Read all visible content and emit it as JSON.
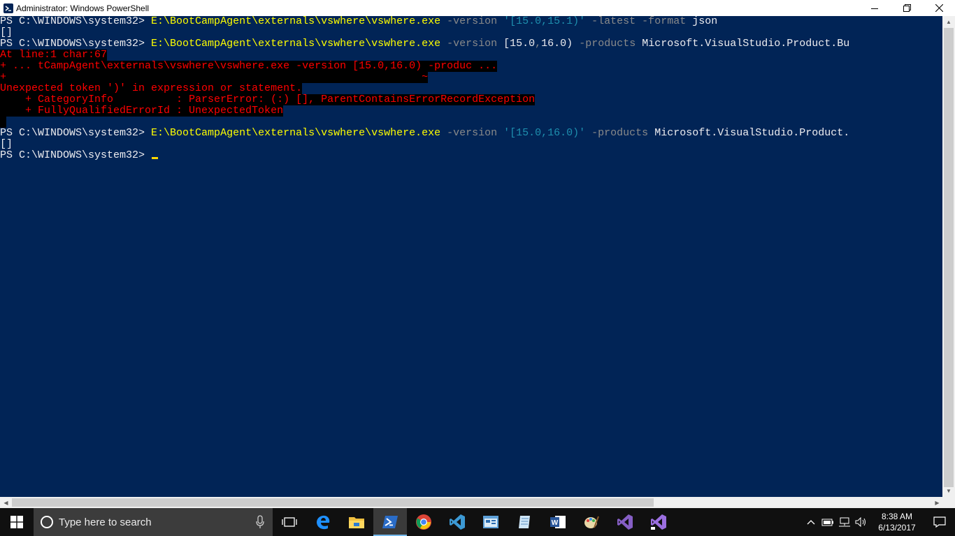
{
  "window": {
    "title": "Administrator: Windows PowerShell",
    "icon": "powershell-icon"
  },
  "console": {
    "lines": [
      {
        "segments": [
          {
            "t": "PS C:\\WINDOWS\\system32> ",
            "c": "white"
          },
          {
            "t": "E:\\BootCampAgent\\externals\\vswhere\\vswhere.exe",
            "c": "yellow"
          },
          {
            "t": " -version ",
            "c": "gray"
          },
          {
            "t": "'[15.0,15.1)'",
            "c": "str"
          },
          {
            "t": " -latest -format ",
            "c": "gray"
          },
          {
            "t": "json",
            "c": "white"
          }
        ]
      },
      {
        "segments": [
          {
            "t": "[]",
            "c": "white"
          }
        ]
      },
      {
        "segments": [
          {
            "t": "PS C:\\WINDOWS\\system32> ",
            "c": "white"
          },
          {
            "t": "E:\\BootCampAgent\\externals\\vswhere\\vswhere.exe",
            "c": "yellow"
          },
          {
            "t": " -version ",
            "c": "gray"
          },
          {
            "t": "[15.0",
            "c": "white"
          },
          {
            "t": ",",
            "c": "gray"
          },
          {
            "t": "16.0)",
            "c": "white"
          },
          {
            "t": " -products ",
            "c": "gray"
          },
          {
            "t": "Microsoft.VisualStudio.Product.Bu",
            "c": "white"
          }
        ]
      },
      {
        "segments": [
          {
            "t": "At line:1 char:67",
            "c": "red",
            "bg": true
          }
        ]
      },
      {
        "segments": [
          {
            "t": "+ ... tCampAgent\\externals\\vswhere\\vswhere.exe -version [15.0,16.0) -produc ...",
            "c": "red",
            "bg": true
          }
        ]
      },
      {
        "segments": [
          {
            "t": "+                                                                  ~",
            "c": "red",
            "bg": true
          }
        ]
      },
      {
        "segments": [
          {
            "t": "Unexpected token ')' in expression or statement.",
            "c": "red",
            "bg": true
          }
        ]
      },
      {
        "segments": [
          {
            "t": "    + CategoryInfo          : ParserError: (:) [], ParentContainsErrorRecordException",
            "c": "red",
            "bg": true
          }
        ]
      },
      {
        "segments": [
          {
            "t": "    + FullyQualifiedErrorId : UnexpectedToken",
            "c": "red",
            "bg": true
          }
        ]
      },
      {
        "segments": [
          {
            "t": " ",
            "c": "white",
            "bg": true
          }
        ]
      },
      {
        "segments": [
          {
            "t": "PS C:\\WINDOWS\\system32> ",
            "c": "white"
          },
          {
            "t": "E:\\BootCampAgent\\externals\\vswhere\\vswhere.exe",
            "c": "yellow"
          },
          {
            "t": " -version ",
            "c": "gray"
          },
          {
            "t": "'[15.0,16.0)'",
            "c": "str"
          },
          {
            "t": " -products ",
            "c": "gray"
          },
          {
            "t": "Microsoft.VisualStudio.Product.",
            "c": "white"
          }
        ]
      },
      {
        "segments": [
          {
            "t": "[]",
            "c": "white"
          }
        ]
      },
      {
        "segments": [
          {
            "t": "PS C:\\WINDOWS\\system32> ",
            "c": "white"
          }
        ],
        "cursor": true
      }
    ]
  },
  "taskbar": {
    "search_placeholder": "Type here to search",
    "apps": [
      {
        "name": "task-view-icon",
        "active": false
      },
      {
        "name": "edge-icon",
        "active": false
      },
      {
        "name": "file-explorer-icon",
        "active": false
      },
      {
        "name": "powershell-icon",
        "active": true
      },
      {
        "name": "chrome-icon",
        "active": false
      },
      {
        "name": "vscode-icon",
        "active": false
      },
      {
        "name": "app-window-icon",
        "active": false
      },
      {
        "name": "notepad-icon",
        "active": false
      },
      {
        "name": "word-icon",
        "active": false
      },
      {
        "name": "paint-icon",
        "active": false
      },
      {
        "name": "visual-studio-icon",
        "active": false
      },
      {
        "name": "visual-studio-preview-icon",
        "active": false
      }
    ],
    "clock": {
      "time": "8:38 AM",
      "date": "6/13/2017"
    }
  },
  "colors": {
    "console_bg": "#012456",
    "prompt": "#eeedf0",
    "command": "#ffff00",
    "parameter": "#8a8a8a",
    "string": "#1e8fae",
    "error": "#ff0000"
  }
}
